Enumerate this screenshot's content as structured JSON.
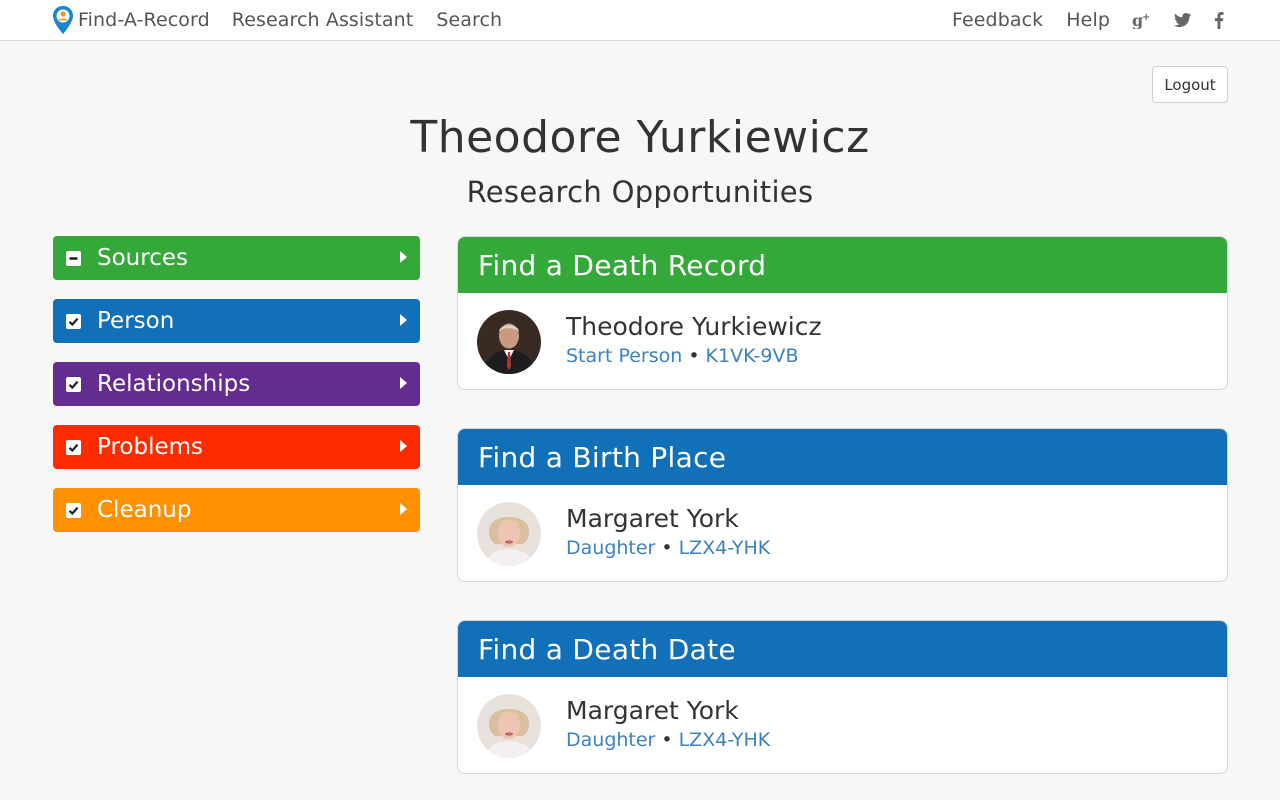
{
  "nav": {
    "brand": "Find-A-Record",
    "links": [
      "Research Assistant",
      "Search"
    ],
    "right_links": [
      "Feedback",
      "Help"
    ],
    "social_icons": [
      "google-plus-icon",
      "twitter-icon",
      "facebook-icon"
    ]
  },
  "logout_label": "Logout",
  "page": {
    "title": "Theodore Yurkiewicz",
    "subtitle": "Research Opportunities"
  },
  "sidebar": {
    "items": [
      {
        "label": "Sources",
        "state": "partial",
        "color": "#34a93a"
      },
      {
        "label": "Person",
        "state": "checked",
        "color": "#1170b7"
      },
      {
        "label": "Relationships",
        "state": "checked",
        "color": "#652c8f"
      },
      {
        "label": "Problems",
        "state": "checked",
        "color": "#ff2b00"
      },
      {
        "label": "Cleanup",
        "state": "checked",
        "color": "#ff9100"
      }
    ]
  },
  "cards": [
    {
      "title": "Find a Death Record",
      "color": "#34a93a",
      "person": {
        "name": "Theodore Yurkiewicz",
        "relation": "Start Person",
        "id": "K1VK-9VB"
      }
    },
    {
      "title": "Find a Birth Place",
      "color": "#1170b7",
      "person": {
        "name": "Margaret York",
        "relation": "Daughter",
        "id": "LZX4-YHK"
      }
    },
    {
      "title": "Find a Death Date",
      "color": "#1170b7",
      "person": {
        "name": "Margaret York",
        "relation": "Daughter",
        "id": "LZX4-YHK"
      }
    }
  ],
  "colors": {
    "link": "#3a82c4",
    "nav_text": "#555555",
    "page_bg": "#f7f7f7"
  }
}
